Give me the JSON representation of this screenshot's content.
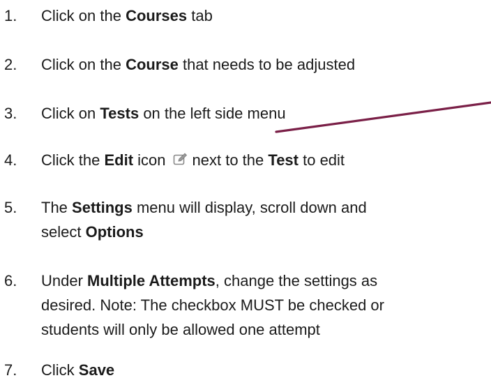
{
  "steps": [
    {
      "num": "1.",
      "a": "Click on the ",
      "b1": "Courses",
      "c": " tab"
    },
    {
      "num": "2.",
      "a": "Click on the ",
      "b1": "Course",
      "c": " that needs to be adjusted"
    },
    {
      "num": "3.",
      "a": "Click on ",
      "b1": "Tests",
      "c": " on the left side menu"
    },
    {
      "num": "4.",
      "a": "Click the ",
      "b1": "Edit",
      "c": " icon",
      "d": "next to the ",
      "b2": "Test",
      "e": " to edit"
    },
    {
      "num": "5.",
      "a": "The ",
      "b1": "Settings",
      "c": " menu will display, scroll down and",
      "line2a": "select ",
      "line2b": "Options"
    },
    {
      "num": "6.",
      "a": "Under ",
      "b1": "Multiple Attempts",
      "c": ", change the settings as",
      "line2": "desired. Note: The checkbox MUST be checked or",
      "line3": "students will only be allowed one attempt"
    },
    {
      "num": "7.",
      "a": "Click ",
      "b1": "Save"
    }
  ],
  "icons": {
    "edit": "edit-pencil-icon"
  },
  "colors": {
    "pointer_line": "#7a1f47",
    "text": "#1a1a1a",
    "icon_stroke": "#888888"
  }
}
